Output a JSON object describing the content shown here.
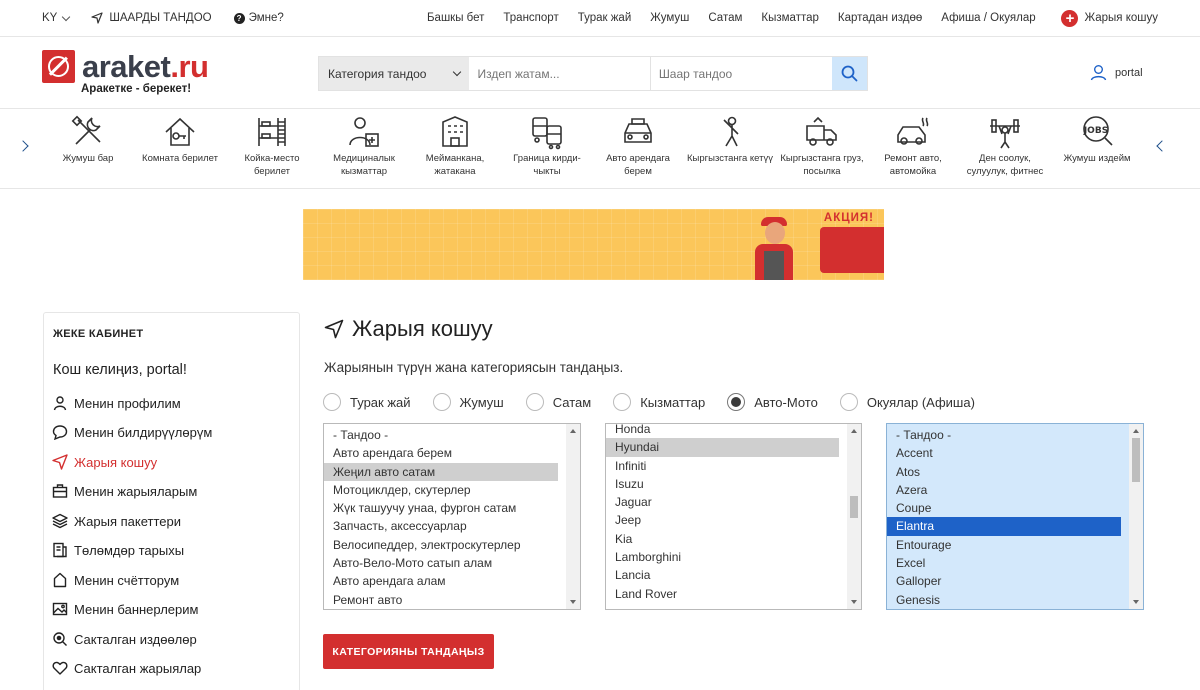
{
  "topbar": {
    "lang": "KY",
    "city_label": "ШААРДЫ ТАНДОО",
    "what_label": "Эмне?",
    "nav": [
      "Башкы бет",
      "Транспорт",
      "Турак жай",
      "Жумуш",
      "Сатам",
      "Кызматтар",
      "Картадан издөө",
      "Афиша / Окуялар"
    ],
    "add_label": "Жарыя кошуу"
  },
  "header": {
    "logo_main": "araket",
    "logo_tld": ".ru",
    "tagline": "Аракетке - берекет!",
    "category_select": "Категория тандоо",
    "search_placeholder": "Издеп жатам...",
    "city_placeholder": "Шаар тандоо",
    "user_name": "portal"
  },
  "categories": [
    {
      "label": "Жумуш бар",
      "icon": "tools-icon"
    },
    {
      "label": "Комната берилет",
      "icon": "house-key-icon"
    },
    {
      "label": "Койка-место берилет",
      "icon": "bunk-bed-icon"
    },
    {
      "label": "Медициналык кызматтар",
      "icon": "doctor-icon"
    },
    {
      "label": "Мейманкана, жатакана",
      "icon": "hotel-icon"
    },
    {
      "label": "Граница кирди-чыкты",
      "icon": "bus-icon"
    },
    {
      "label": "Авто арендага берем",
      "icon": "car-icon"
    },
    {
      "label": "Кыргызстанга кетүү",
      "icon": "person-icon"
    },
    {
      "label": "Кыргызстанга груз, посылка",
      "icon": "truck-icon"
    },
    {
      "label": "Ремонт авто, автомойка",
      "icon": "car-wash-icon"
    },
    {
      "label": "Ден соолук, сулуулук, фитнес",
      "icon": "fitness-icon"
    },
    {
      "label": "Жумуш издейм",
      "icon": "jobs-icon"
    }
  ],
  "banner": {
    "badge": "АКЦИЯ!"
  },
  "sidebar": {
    "title": "ЖЕКЕ КАБИНЕТ",
    "welcome": "Кош келиңиз, portal!",
    "items": [
      {
        "label": "Менин профилим",
        "icon": "user-icon"
      },
      {
        "label": "Менин билдирүүлөрүм",
        "icon": "chat-icon"
      },
      {
        "label": "Жарыя кошуу",
        "icon": "send-icon",
        "active": true
      },
      {
        "label": "Менин жарыяларым",
        "icon": "briefcase-icon"
      },
      {
        "label": "Жарыя пакеттери",
        "icon": "layers-icon"
      },
      {
        "label": "Төлөмдөр тарыхы",
        "icon": "receipt-icon"
      },
      {
        "label": "Менин счётторум",
        "icon": "home-icon"
      },
      {
        "label": "Менин баннерлерим",
        "icon": "image-icon"
      },
      {
        "label": "Сакталган издөөлөр",
        "icon": "search-icon"
      },
      {
        "label": "Сакталган жарыялар",
        "icon": "heart-icon"
      }
    ]
  },
  "main": {
    "title": "Жарыя кошуу",
    "subtitle": "Жарыянын түрүн жана категориясын тандаңыз.",
    "types": [
      "Турак жай",
      "Жумуш",
      "Сатам",
      "Кызматтар",
      "Авто-Мото",
      "Окуялар (Афиша)"
    ],
    "selected_type": "Авто-Мото",
    "list1": [
      "- Тандоо -",
      "Авто арендага берем",
      "Жеңил авто сатам",
      "Мотоциклдер, скутерлер",
      "Жүк ташуучу унаа, фургон сатам",
      "Запчасть, аксессуарлар",
      "Велосипеддер, электроскутерлер",
      "Авто-Вело-Мото сатып алам",
      "Авто арендага алам",
      "Ремонт авто"
    ],
    "list1_selected": "Жеңил авто сатам",
    "list2": [
      "Honda",
      "Hyundai",
      "Infiniti",
      "Isuzu",
      "Jaguar",
      "Jeep",
      "Kia",
      "Lamborghini",
      "Lancia",
      "Land Rover"
    ],
    "list2_selected": "Hyundai",
    "list3": [
      "- Тандоо -",
      "Accent",
      "Atos",
      "Azera",
      "Coupe",
      "Elantra",
      "Entourage",
      "Excel",
      "Galloper",
      "Genesis"
    ],
    "list3_selected": "Elantra",
    "submit_label": "КАТЕГОРИЯНЫ ТАНДАҢЫЗ"
  },
  "colors": {
    "accent": "#d32f2f",
    "select_blue": "#1e62c8",
    "list_blue_bg": "#d3e8fb"
  }
}
